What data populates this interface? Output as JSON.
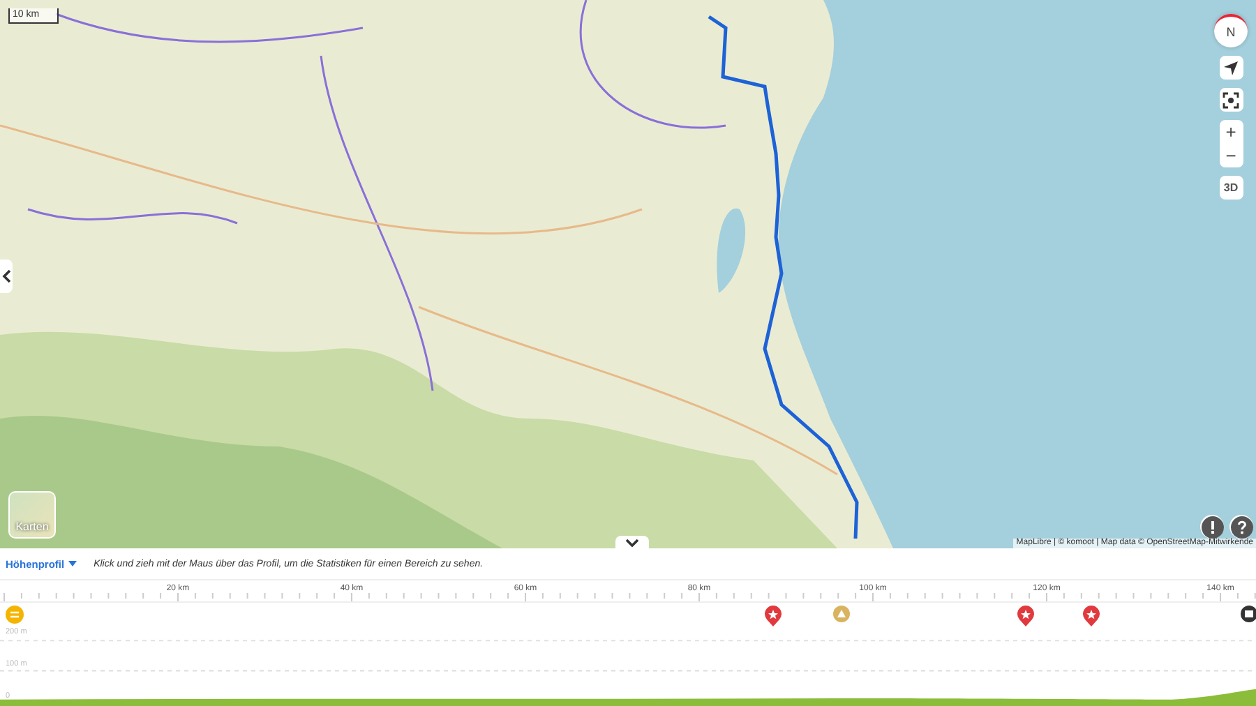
{
  "map": {
    "scale": "10 km",
    "layers_button": "Karten",
    "attribution": "MapLibre | © komoot | Map data © OpenStreetMap-Mitwirkende",
    "compass": "N",
    "zoom_in": "+",
    "zoom_out": "−",
    "view_3d": "3D"
  },
  "profile": {
    "title": "Höhenprofil",
    "hint": "Klick und zieh mit der Maus über das Profil, um die Statistiken für einen Bereich zu sehen.",
    "x_ticks": [
      "20 km",
      "40 km",
      "60 km",
      "80 km",
      "100 km",
      "120 km",
      "140 km"
    ],
    "y_labels": [
      "200 m",
      "100 m",
      "0"
    ],
    "markers": [
      {
        "kind": "start"
      },
      {
        "kind": "highlight"
      },
      {
        "kind": "poi"
      },
      {
        "kind": "highlight"
      },
      {
        "kind": "highlight"
      },
      {
        "kind": "end"
      }
    ]
  }
}
